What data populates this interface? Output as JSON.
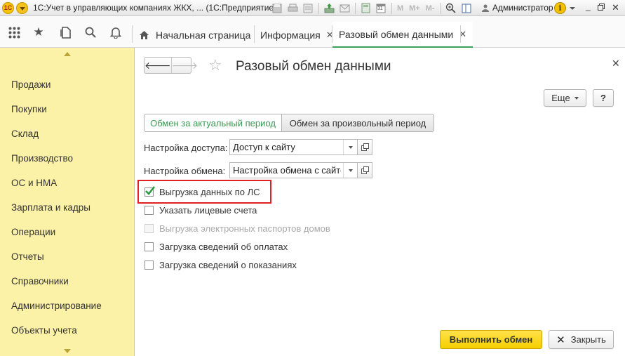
{
  "titlebar": {
    "logo_text": "1С",
    "title": "1С:Учет в управляющих компаниях ЖКХ, ...  (1С:Предприятие)",
    "m_label": "M",
    "mplus_label": "M+",
    "mminus_label": "M-",
    "calendar_day": "31",
    "user": "Администратор",
    "info_glyph": "i"
  },
  "nav": {
    "tabs": [
      {
        "label": "Начальная страница"
      },
      {
        "label": "Информация"
      },
      {
        "label": "Разовый обмен данными"
      }
    ],
    "tab_close_glyph": "✕"
  },
  "sidebar": {
    "items": [
      {
        "label": "Продажи"
      },
      {
        "label": "Покупки"
      },
      {
        "label": "Склад"
      },
      {
        "label": "Производство"
      },
      {
        "label": "ОС и НМА"
      },
      {
        "label": "Зарплата и кадры"
      },
      {
        "label": "Операции"
      },
      {
        "label": "Отчеты"
      },
      {
        "label": "Справочники"
      },
      {
        "label": "Администрирование"
      },
      {
        "label": "Объекты учета"
      }
    ]
  },
  "form": {
    "title": "Разовый обмен данными",
    "more_label": "Еще",
    "help_label": "?",
    "close_glyph": "✕",
    "mode_tabs": [
      {
        "label": "Обмен за актуальный период",
        "active": true
      },
      {
        "label": "Обмен за произвольный период",
        "active": false
      }
    ],
    "fields": {
      "access_label": "Настройка доступа:",
      "access_value": "Доступ к сайту",
      "exchange_label": "Настройка обмена:",
      "exchange_value": "Настройка обмена с сайтом"
    },
    "checkboxes": [
      {
        "label": "Выгрузка данных по ЛС",
        "checked": true,
        "enabled": true
      },
      {
        "label": "Указать лицевые счета",
        "checked": false,
        "enabled": true
      },
      {
        "label": "Выгрузка электронных паспортов домов",
        "checked": false,
        "enabled": false
      },
      {
        "label": "Загрузка сведений об оплатах",
        "checked": false,
        "enabled": true
      },
      {
        "label": "Загрузка сведений о показаниях",
        "checked": false,
        "enabled": true
      }
    ],
    "run_label": "Выполнить обмен",
    "close_label": "Закрыть"
  },
  "colors": {
    "sidebar_bg": "#fbf1a7",
    "accent_green": "#3a9a53",
    "primary_button": "#f5cf00",
    "highlight_red": "#e02020"
  }
}
